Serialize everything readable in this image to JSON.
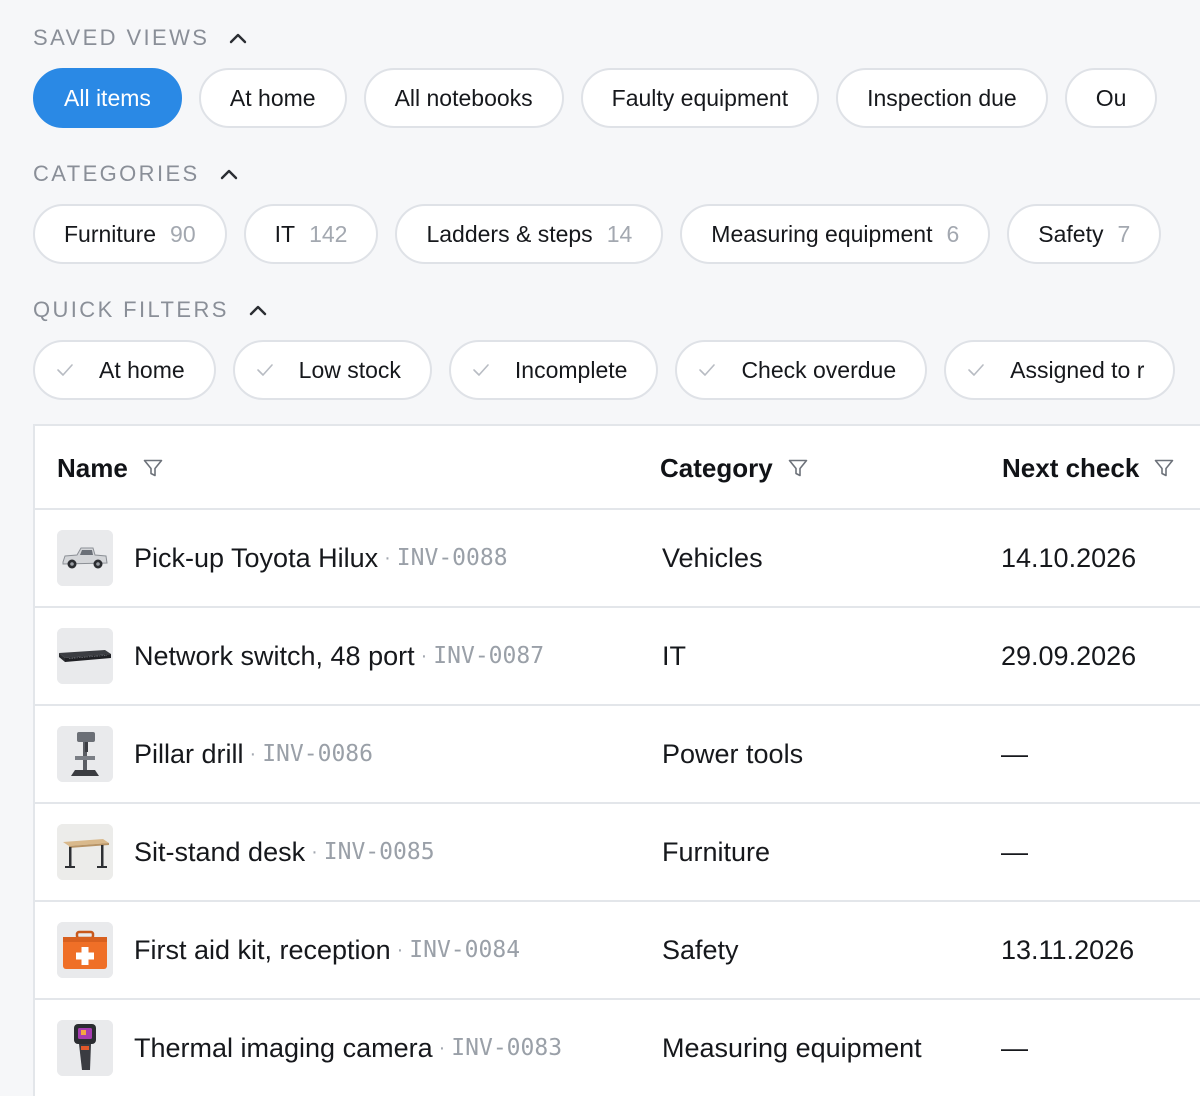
{
  "saved_views": {
    "heading": "SAVED VIEWS",
    "items": [
      "All items",
      "At home",
      "All notebooks",
      "Faulty equipment",
      "Inspection due",
      "Ou"
    ]
  },
  "categories": {
    "heading": "CATEGORIES",
    "items": [
      {
        "label": "Furniture",
        "count": "90"
      },
      {
        "label": "IT",
        "count": "142"
      },
      {
        "label": "Ladders & steps",
        "count": "14"
      },
      {
        "label": "Measuring equipment",
        "count": "6"
      },
      {
        "label": "Safety",
        "count": "7"
      }
    ]
  },
  "quick_filters": {
    "heading": "QUICK FILTERS",
    "items": [
      "At home",
      "Low stock",
      "Incomplete",
      "Check overdue",
      "Assigned to r"
    ]
  },
  "table": {
    "columns": [
      "Name",
      "Category",
      "Next check"
    ],
    "rows": [
      {
        "name": "Pick-up Toyota Hilux",
        "code": "INV-0088",
        "category": "Vehicles",
        "next_check": "14.10.2026",
        "thumb": "pickup-truck-icon"
      },
      {
        "name": "Network switch, 48 port",
        "code": "INV-0087",
        "category": "IT",
        "next_check": "29.09.2026",
        "thumb": "network-switch-icon"
      },
      {
        "name": "Pillar drill",
        "code": "INV-0086",
        "category": "Power tools",
        "next_check": "—",
        "thumb": "pillar-drill-icon"
      },
      {
        "name": "Sit-stand desk",
        "code": "INV-0085",
        "category": "Furniture",
        "next_check": "—",
        "thumb": "desk-icon"
      },
      {
        "name": "First aid kit, reception",
        "code": "INV-0084",
        "category": "Safety",
        "next_check": "13.11.2026",
        "thumb": "first-aid-kit-icon"
      },
      {
        "name": "Thermal imaging camera",
        "code": "INV-0083",
        "category": "Measuring equipment",
        "next_check": "—",
        "thumb": "thermal-camera-icon"
      }
    ]
  },
  "separator": "·",
  "colors": {
    "accent": "#2a89e5",
    "muted": "#8a8f98",
    "border": "#dfe2e7"
  }
}
